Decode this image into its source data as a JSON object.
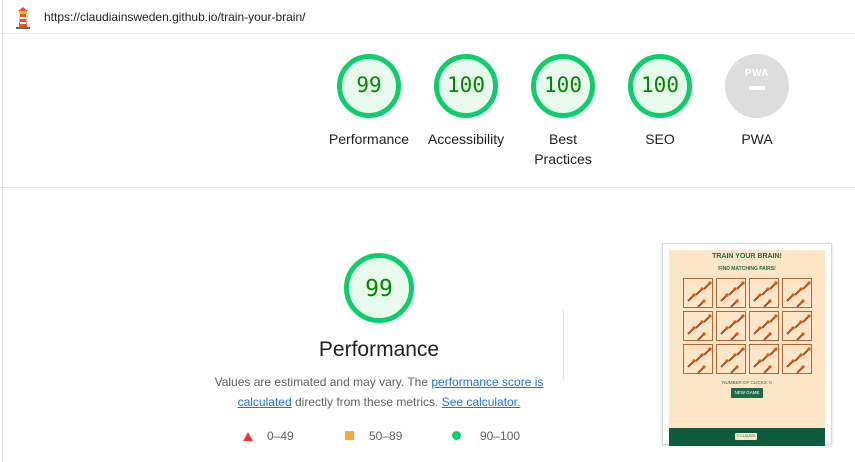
{
  "topbar": {
    "url": "https://claudiainsweden.github.io/train-your-brain/"
  },
  "gauges": [
    {
      "label": "Performance",
      "score": "99"
    },
    {
      "label": "Accessibility",
      "score": "100"
    },
    {
      "label": "Best Practices",
      "score": "100"
    },
    {
      "label": "SEO",
      "score": "100"
    },
    {
      "label": "PWA",
      "badge_text": "PWA"
    }
  ],
  "performance": {
    "score": "99",
    "title": "Performance",
    "desc_prefix": "Values are estimated and may vary. The ",
    "link_score": "performance score is calculated",
    "desc_middle": " directly from these metrics. ",
    "link_calculator": "See calculator."
  },
  "legend": {
    "fail": "0–49",
    "average": "50–89",
    "pass": "90–100"
  },
  "screenshot": {
    "title": "TRAIN YOUR BRAIN!",
    "subtitle": "FIND MATCHING PAIRS!",
    "count_text": "NUMBER OF CLICKS: 0",
    "button": "NEW GAME",
    "footer_pill": "© CLAUDIA"
  },
  "colors": {
    "pass": "#0cce6b",
    "pass_text": "#008800",
    "average": "#ffaa33",
    "fail": "#ff3333",
    "link": "#1a73e8",
    "pwa_gray": "#dddddd",
    "shot_bg": "#fde6c8",
    "shot_green": "#0f5b3e"
  },
  "icons": [
    "lighthouse-icon",
    "pwa-badge-icon",
    "triangle-fail-icon",
    "square-average-icon",
    "circle-pass-icon"
  ]
}
